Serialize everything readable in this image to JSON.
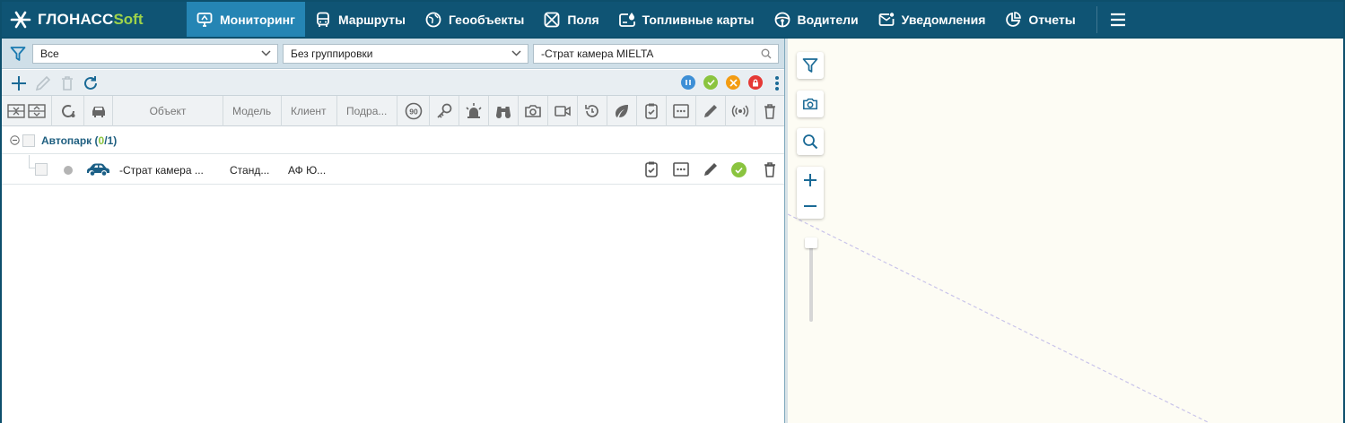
{
  "logo": {
    "part1": "ГЛОНАСС",
    "part2": "Soft"
  },
  "nav": {
    "items": [
      {
        "label": "Мониторинг",
        "icon": "monitor-icon",
        "active": true
      },
      {
        "label": "Маршруты",
        "icon": "bus-icon"
      },
      {
        "label": "Геообъекты",
        "icon": "globe-icon"
      },
      {
        "label": "Поля",
        "icon": "field-icon"
      },
      {
        "label": "Топливные карты",
        "icon": "fuel-card-icon"
      },
      {
        "label": "Водители",
        "icon": "steering-wheel-icon"
      },
      {
        "label": "Уведомления",
        "icon": "mail-icon"
      },
      {
        "label": "Отчеты",
        "icon": "reports-icon"
      }
    ],
    "menu_icon": "hamburger-icon"
  },
  "filters": {
    "status_select": "Все",
    "grouping_select": "Без группировки",
    "search_value": "-Страт камера MIELTA"
  },
  "columns": {
    "object": "Объект",
    "model": "Модель",
    "client": "Клиент",
    "division": "Подра..."
  },
  "group": {
    "name": "Автопарк",
    "count_open": "(",
    "count_active": "0",
    "count_sep": "/",
    "count_total": "1",
    "count_close": ")"
  },
  "rows": [
    {
      "object": "-Страт камера ...",
      "model": "Станд...",
      "client": "АФ Ю..."
    }
  ],
  "colors": {
    "nav_bg": "#0f5474",
    "nav_active": "#2585b4",
    "brand_green": "#9ed34a",
    "icon_blue": "#1a6a96",
    "status_blue": "#3d8fd6",
    "status_green": "#8ac43f",
    "status_orange": "#f39c12",
    "status_red": "#e53935"
  }
}
